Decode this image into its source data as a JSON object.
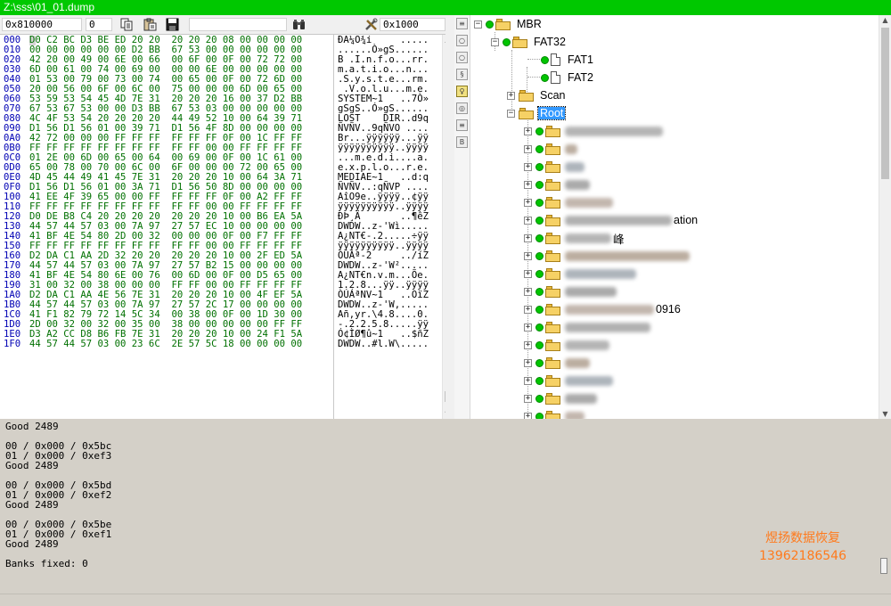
{
  "window": {
    "title": "Z:\\sss\\01_01.dump"
  },
  "toolbar": {
    "offset": "0x810000",
    "value": "0",
    "search_value": "",
    "goto_value": "0x1000",
    "icons": [
      "copy-icon",
      "paste-icon",
      "save-icon",
      "binoculars-icon",
      "tools-icon"
    ]
  },
  "hex": {
    "addresses": "000\n010\n020\n030\n040\n050\n060\n070\n080\n090\n0A0\n0B0\n0C0\n0D0\n0E0\n0F0\n100\n110\n120\n130\n140\n150\n160\n170\n180\n190\n1A0\n1B0\n1C0\n1D0\n1E0\n1F0",
    "bytes": "D0 C2 BC D3 BE ED 20 20  20 20 20 08 00 00 00 00\n00 00 00 00 00 00 D2 BB  67 53 00 00 00 00 00 00\n42 20 00 49 00 6E 00 66  00 6F 00 0F 00 72 72 00\n6D 00 61 00 74 00 69 00  00 00 6E 00 00 00 00 00\n01 53 00 79 00 73 00 74  00 65 00 0F 00 72 6D 00\n20 00 56 00 6F 00 6C 00  75 00 00 00 6D 00 65 00\n53 59 53 54 45 4D 7E 31  20 20 20 16 00 37 D2 BB\n67 53 67 53 00 00 D3 BB  67 53 03 00 00 00 00 00\n4C 4F 53 54 20 20 20 20  44 49 52 10 00 64 39 71\nD1 56 D1 56 01 00 39 71  D1 56 4F 8D 00 00 00 00\n42 72 00 00 00 FF FF FF  FF FF FF 0F 00 1C FF FF\nFF FF FF FF FF FF FF FF  FF FF 00 00 FF FF FF FF\n01 2E 00 6D 00 65 00 64  00 69 00 0F 00 1C 61 00\n65 00 78 00 70 00 6C 00  6F 00 00 00 72 00 65 00\n4D 45 44 49 41 45 7E 31  20 20 20 10 00 64 3A 71\nD1 56 D1 56 01 00 3A 71  D1 56 50 8D 00 00 00 00\n41 EE 4F 39 65 00 00 FF  FF FF FF 0F 00 A2 FF FF\nFF FF FF FF FF FF FF FF  FF FF 00 00 FF FF FF FF\nD0 DE B8 C4 20 20 20 20  20 20 20 10 00 B6 EA 5A\n44 57 44 57 03 00 7A 97  27 57 EC 10 00 00 00 00\n41 BF 4E 54 80 2D 00 32  00 00 00 0F 00 F7 FF FF\nFF FF FF FF FF FF FF FF  FF FF 00 00 FF FF FF FF\nD2 DA C1 AA 2D 32 20 20  20 20 20 10 00 2F ED 5A\n44 57 44 57 03 00 7A 97  27 57 B2 15 00 00 00 00\n41 BF 4E 54 80 6E 00 76  00 6D 00 0F 00 D5 65 00\n31 00 32 00 38 00 00 00  FF FF 00 00 FF FF FF FF\nD2 DA C1 AA 4E 56 7E 31  20 20 20 10 00 4F EF 5A\n44 57 44 57 03 00 7A 97  27 57 2C 17 00 00 00 00\n41 F1 82 79 72 14 5C 34  00 38 00 0F 00 1D 30 00\n2D 00 32 00 32 00 35 00  38 00 00 00 00 00 FF FF\nD3 A2 CC D8 B6 FB 7E 31  20 20 20 10 00 24 F1 5A\n44 57 44 57 03 00 23 6C  2E 57 5C 18 00 00 00 00",
    "ascii": "ÐÂ¼Ó¾í     .....\n......Ò»gS......\nB .I.n.f.o...rr.\nm.a.t.i.o...n...\n.S.y.s.t.e...rm.\n .V.o.l.u...m.e.\nSYSTEM~1   ..7Ò»\ngSgS..Ó»gS......\nLOST    DIR..d9q\nÑVÑV..9qÑVO ....\nBr...ÿÿÿÿÿÿ...ÿÿ\nÿÿÿÿÿÿÿÿÿÿ..ÿÿÿÿ\n...m.e.d.i....a.\ne.x.p.l.o...r.e.\nMEDIAE~1   ..d:q\nÑVÑV..:qÑVP ....\nAîO9e..ÿÿÿÿ..¢ÿÿ\nÿÿÿÿÿÿÿÿÿÿ..ÿÿÿÿ\nÐÞ¸Ä       ..¶êZ\nDWDW..z-'Wì.....\nA¿NT€-.2.....÷ÿÿ\nÿÿÿÿÿÿÿÿÿÿ..ÿÿÿÿ\nÒÚÁª-2     ../íZ\nDWDW..z-'W².....\nA¿NT€n.v.m...Õe.\n1.2.8...ÿÿ..ÿÿÿÿ\nÒÚÁªNV~1   ..OïZ\nDWDW..z-'W,.....\nAñ‚yr.\\4.8....0.\n-.2.2.5.8.....ÿÿ\nÓ¢ÌØ¶û~1   ..$ñZ\nDWDW..#l.W\\....."
  },
  "tree": {
    "root": {
      "label": "MBR"
    },
    "fat32": {
      "label": "FAT32"
    },
    "fat1": {
      "label": "FAT1"
    },
    "fat2": {
      "label": "FAT2"
    },
    "scan": {
      "label": "Scan"
    },
    "root_dir": {
      "label": "Root"
    },
    "partial_labels": [
      "ation",
      "峰",
      "0916"
    ]
  },
  "log": {
    "text": "Good 2489\n\n00 / 0x000 / 0x5bc\n01 / 0x000 / 0xef3\nGood 2489\n\n00 / 0x000 / 0x5bd\n01 / 0x000 / 0xef2\nGood 2489\n\n00 / 0x000 / 0x5be\n01 / 0x000 / 0xef1\nGood 2489\n\nBanks fixed: 0"
  },
  "watermark": {
    "line1": "煜扬数据恢复",
    "line2": "13962186546"
  },
  "colors": {
    "titlebar": "#00c800",
    "hex_address": "#0000b4",
    "hex_bytes": "#007000",
    "status_dot": "#00c400",
    "folder": "#f6d165",
    "selection": "#3399ff",
    "log_bg": "#d4d0c8",
    "watermark": "#ff7a1c"
  }
}
